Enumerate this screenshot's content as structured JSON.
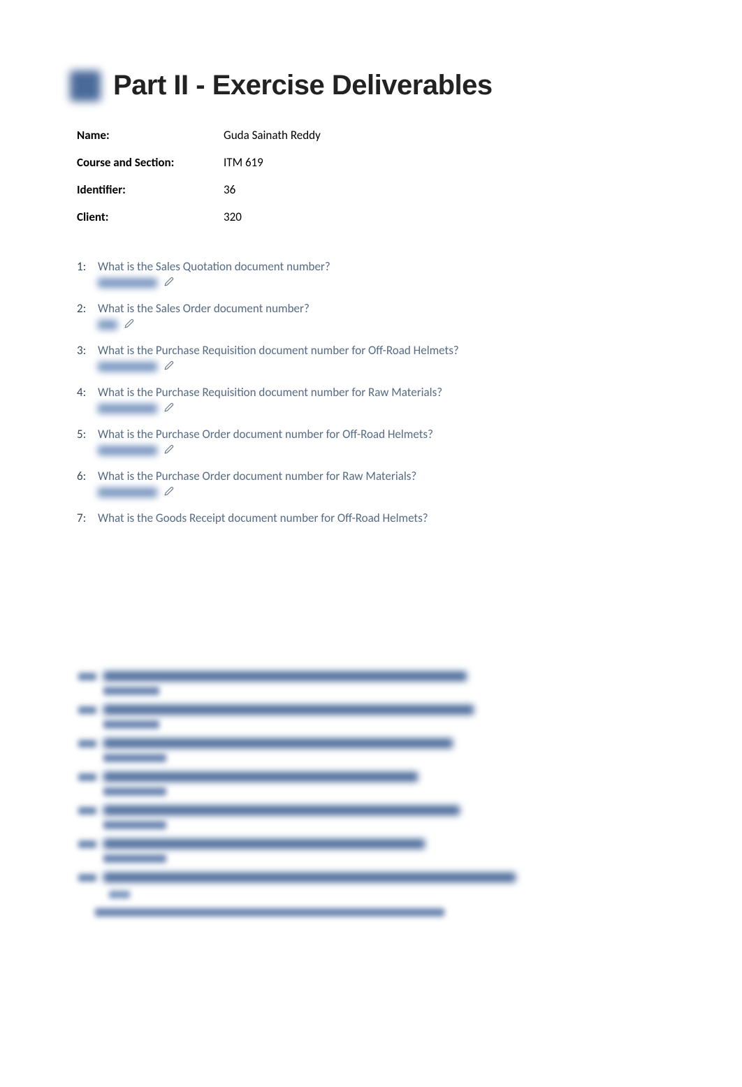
{
  "title": "Part II - Exercise Deliverables",
  "meta": {
    "name_label": "Name:",
    "name_value": "Guda Sainath Reddy",
    "course_label": "Course and Section:",
    "course_value": "ITM 619",
    "identifier_label": "Identifier:",
    "identifier_value": "36",
    "client_label": "Client:",
    "client_value": "320"
  },
  "questions": [
    {
      "text": "What is the Sales Quotation document number?",
      "has_answer": true,
      "answer_width": "normal"
    },
    {
      "text": "What is the Sales Order document number?",
      "has_answer": true,
      "answer_width": "short"
    },
    {
      "text": "What is the Purchase Requisition document number for Off-Road Helmets?",
      "has_answer": true,
      "answer_width": "normal"
    },
    {
      "text": "What is the Purchase Requisition document number for Raw Materials?",
      "has_answer": true,
      "answer_width": "normal"
    },
    {
      "text": "What is the Purchase Order document number for Off-Road Helmets?",
      "has_answer": true,
      "answer_width": "normal"
    },
    {
      "text": "What is the Purchase Order document number for Raw Materials?",
      "has_answer": true,
      "answer_width": "normal"
    },
    {
      "text": "What is the Goods Receipt document number for Off-Road Helmets?",
      "has_answer": false,
      "answer_width": ""
    }
  ],
  "blurred_rows": [
    {
      "main_w": 520,
      "sub_w": 80
    },
    {
      "main_w": 530,
      "sub_w": 80
    },
    {
      "main_w": 500,
      "sub_w": 90
    },
    {
      "main_w": 450,
      "sub_w": 90
    },
    {
      "main_w": 510,
      "sub_w": 90
    },
    {
      "main_w": 460,
      "sub_w": 90
    },
    {
      "main_w": 590,
      "sub_w": 0,
      "sub_small": true
    }
  ],
  "bottom_line_w": 500
}
